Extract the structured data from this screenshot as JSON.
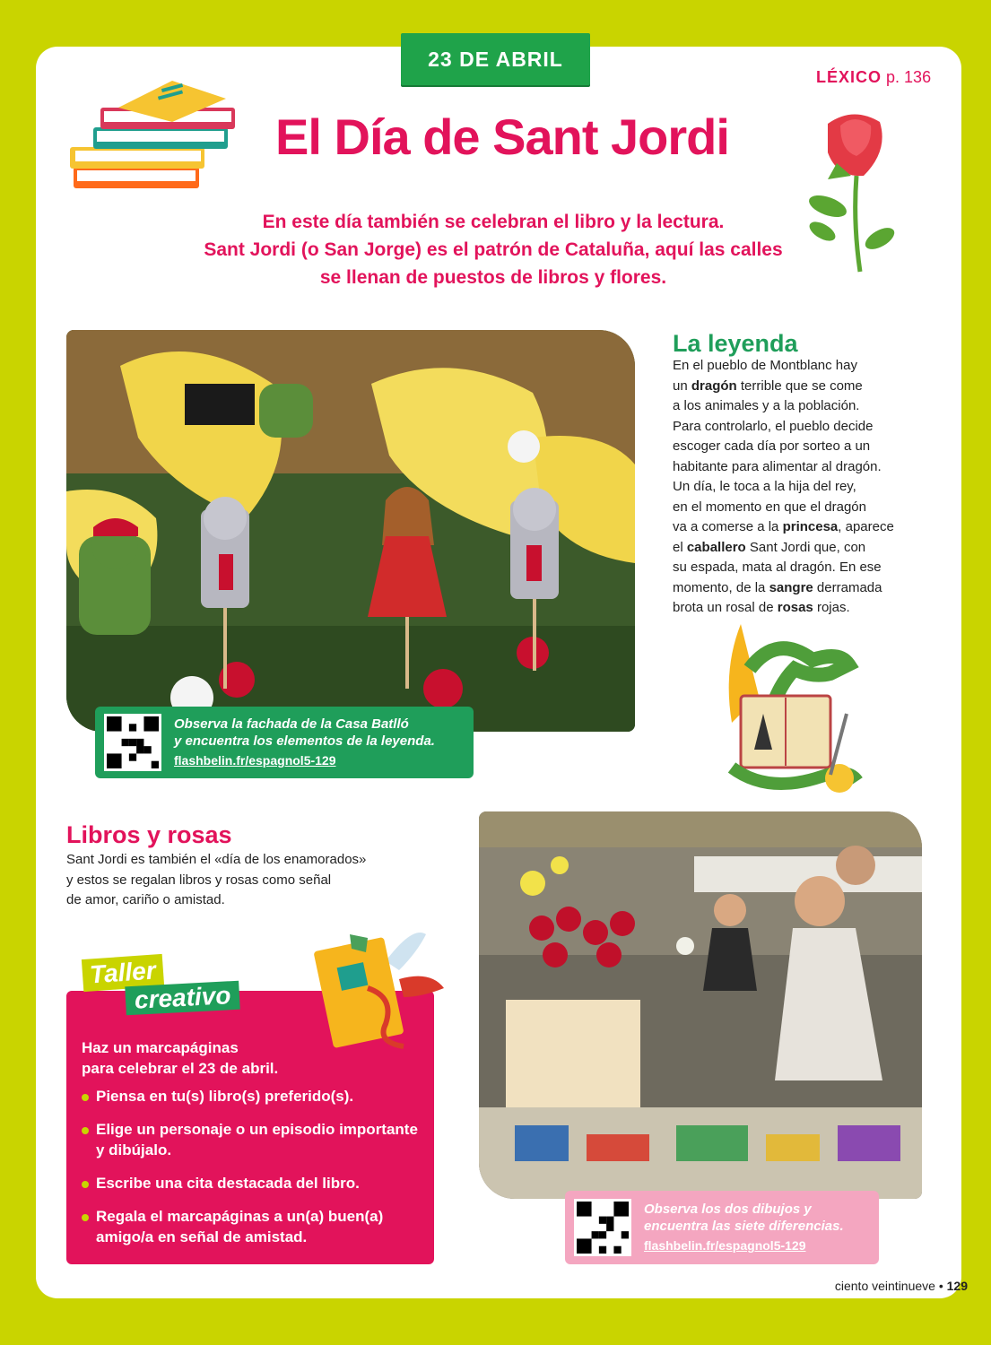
{
  "header": {
    "date_tag": "23 DE ABRIL",
    "lexico_label": "LÉXICO",
    "lexico_page": "p. 136",
    "title": "El Día de Sant Jordi"
  },
  "intro": {
    "line1": "En este día también se celebran el libro y la lectura.",
    "line2": "Sant Jordi (o San Jorge) es el patrón de Cataluña, aquí las calles",
    "line3": "se llenan de puestos de libros y flores."
  },
  "qr1": {
    "text1": "Observa la fachada de la Casa Batlló",
    "text2": "y encuentra los elementos de la leyenda.",
    "link": "flashbelin.fr/espagnol5-129"
  },
  "leyenda": {
    "title": "La leyenda",
    "p1": "En el pueblo de Montblanc hay",
    "p2a": "un ",
    "p2b": "dragón",
    "p2c": " terrible que se come",
    "p3": "a los animales y a la población.",
    "p4": "Para controlarlo, el pueblo decide",
    "p5": "escoger cada día por sorteo a un",
    "p6": "habitante para alimentar al dragón.",
    "p7": "Un día, le toca a la hija del rey,",
    "p8": "en el momento en que el dragón",
    "p9a": "va a comerse a la ",
    "p9b": "princesa",
    "p9c": ", aparece",
    "p10a": "el ",
    "p10b": "caballero",
    "p10c": " Sant Jordi que, con",
    "p11": "su espada, mata al dragón. En ese",
    "p12a": "momento, de la ",
    "p12b": "sangre",
    "p12c": " derramada",
    "p13a": "brota un rosal de ",
    "p13b": "rosas",
    "p13c": " rojas."
  },
  "libros": {
    "title": "Libros y rosas",
    "l1": "Sant Jordi es también el «día de los enamorados»",
    "l2": "y estos se regalan libros y rosas como señal",
    "l3": "de amor, cariño o amistad."
  },
  "taller": {
    "tag1": "Taller",
    "tag2": "creativo",
    "intro1": "Haz un marcapáginas",
    "intro2": "para celebrar el 23 de abril.",
    "items": [
      "Piensa en tu(s) libro(s) preferido(s).",
      "Elige un personaje o un episodio importante y dibújalo.",
      "Escribe una cita destacada del libro.",
      "Regala el marcapáginas a un(a) buen(a) amigo/a en señal de amistad."
    ]
  },
  "qr2": {
    "text1": "Observa los dos dibujos y",
    "text2": "encuentra las siete diferencias.",
    "link": "flashbelin.fr/espagnol5-129"
  },
  "footer": {
    "text": "ciento veintinueve",
    "page": "129"
  },
  "colors": {
    "lime": "#c9d400",
    "pink": "#e2135b",
    "green": "#1f9e5a"
  }
}
